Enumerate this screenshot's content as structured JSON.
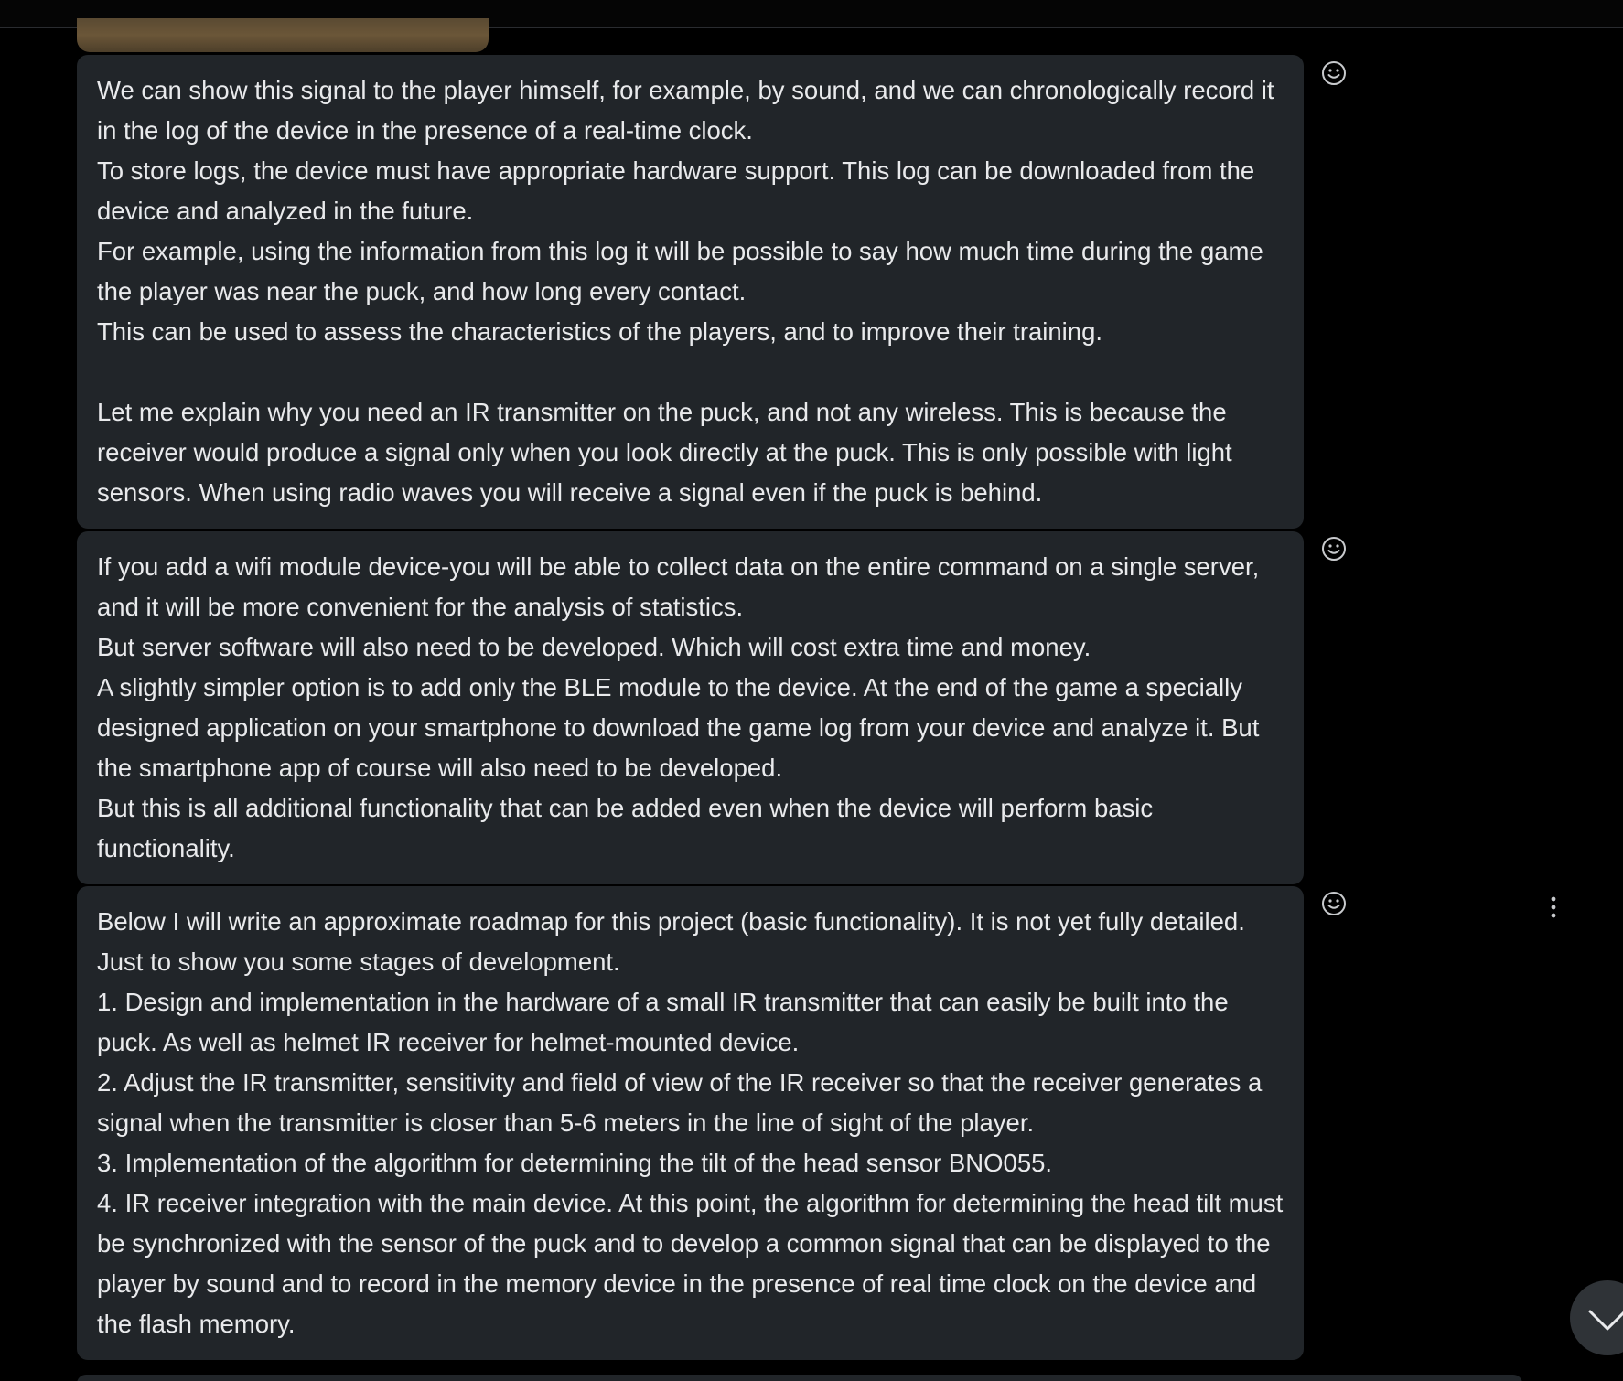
{
  "theme": {
    "background": "#000000",
    "bubble_background": "#212529",
    "text_color": "#e9eaec",
    "icon_color": "#c8cacd"
  },
  "messages": [
    {
      "paragraphs": [
        "We can show this signal to the player himself, for example, by sound, and we can chronologically record it in the log of the device in the presence of a real-time clock.",
        "To store logs, the device must have appropriate hardware support. This log can be downloaded from the device and analyzed in the future.",
        "For example, using the information from this log it will be possible to say how much time during the game the player was near the puck, and how long every contact.",
        "This can be used to assess the characteristics of the players, and to improve their training.",
        "",
        "Let me explain why you need an IR transmitter on the puck, and not any wireless. This is because the receiver would produce a signal only when you look directly at the puck. This is only possible with light sensors. When using radio waves you will receive a signal even if the puck is behind."
      ]
    },
    {
      "paragraphs": [
        "If you add a wifi module device-you will be able to collect data on the entire command on a single server, and it will be more convenient for the analysis of statistics.",
        "But server software will also need to be developed. Which will cost extra time and money.",
        "A slightly simpler option is to add only the BLE module to the device. At the end of the game a specially designed application on your smartphone to download the game log from your device and analyze it. But the smartphone app of course will also need to be developed.",
        "But this is all additional functionality that can be added even when the device will perform basic functionality."
      ]
    },
    {
      "paragraphs": [
        "Below I will write an approximate roadmap for this project (basic functionality). It is not yet fully detailed. Just to show you some stages of development.",
        "1. Design and implementation in the hardware of a small IR transmitter that can easily be built into the puck. As well as helmet IR receiver for helmet-mounted device.",
        "2. Adjust the IR transmitter, sensitivity and field of view of the IR receiver so that the receiver generates a signal when the transmitter is closer than 5-6 meters in the line of sight of the player.",
        "3. Implementation of the algorithm for determining the tilt of the head sensor BNO055.",
        "4. IR receiver integration with the main device. At this point, the algorithm for determining the head tilt must be synchronized with the sensor of the puck and to develop a common signal that can be displayed to the player by sound and to record in the memory device in the presence of real time clock on the device and the flash memory."
      ]
    }
  ],
  "icons": {
    "reaction": "smiley-face-icon",
    "more": "vertical-dots-icon",
    "scroll_down": "chevron-down-icon"
  }
}
